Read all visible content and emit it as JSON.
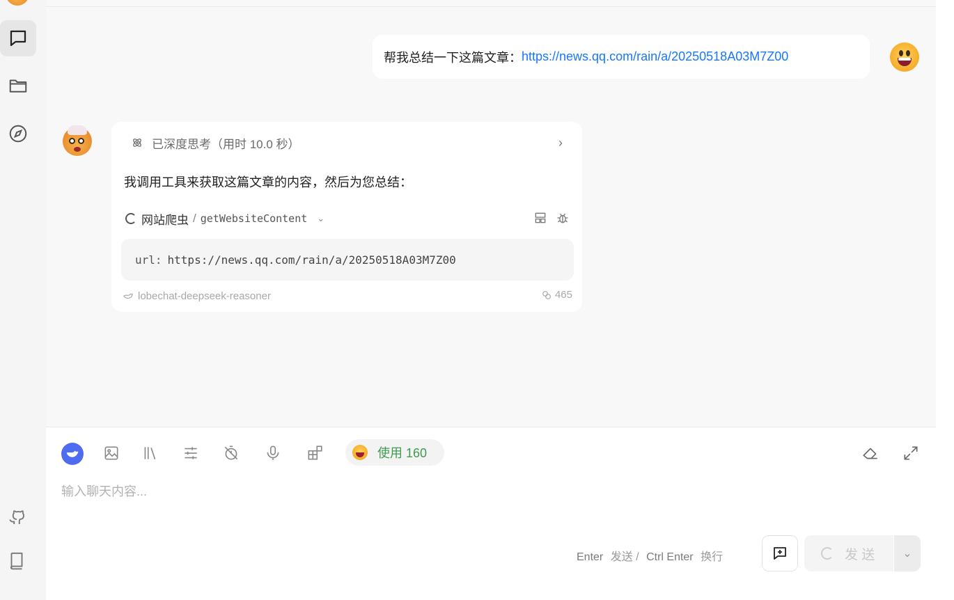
{
  "sidebar": {
    "items": [
      {
        "name": "chat",
        "icon": "chat-bubble-icon",
        "active": true
      },
      {
        "name": "files",
        "icon": "folder-icon",
        "active": false
      },
      {
        "name": "discover",
        "icon": "compass-icon",
        "active": false
      }
    ],
    "bottom": [
      {
        "name": "github",
        "icon": "github-icon"
      },
      {
        "name": "docs",
        "icon": "book-icon"
      }
    ]
  },
  "conversation": {
    "user_message": {
      "text": "帮我总结一下这篇文章：",
      "link": "https://news.qq.com/rain/a/20250518A03M7Z00"
    },
    "assistant_message": {
      "thinking_label": "已深度思考（用时 10.0 秒）",
      "reply": "我调用工具来获取这篇文章的内容，然后为您总结：",
      "tool": {
        "plugin_name": "网站爬虫",
        "separator": "/",
        "api_name": "getWebsiteContent",
        "args_key": "url:",
        "args_value": "https://news.qq.com/rain/a/20250518A03M7Z00"
      },
      "model": "lobechat-deepseek-reasoner",
      "tokens": "465"
    }
  },
  "input": {
    "usage_label": "使用 160",
    "placeholder": "输入聊天内容...",
    "hint_enter": "Enter",
    "hint_send": "发送 /",
    "hint_ctrl_enter": "Ctrl Enter",
    "hint_newline": "换行",
    "send_label": "发 送"
  },
  "colors": {
    "link": "#1677ff",
    "usage_green": "#3f9b4f",
    "model_badge": "#4f6bef"
  }
}
